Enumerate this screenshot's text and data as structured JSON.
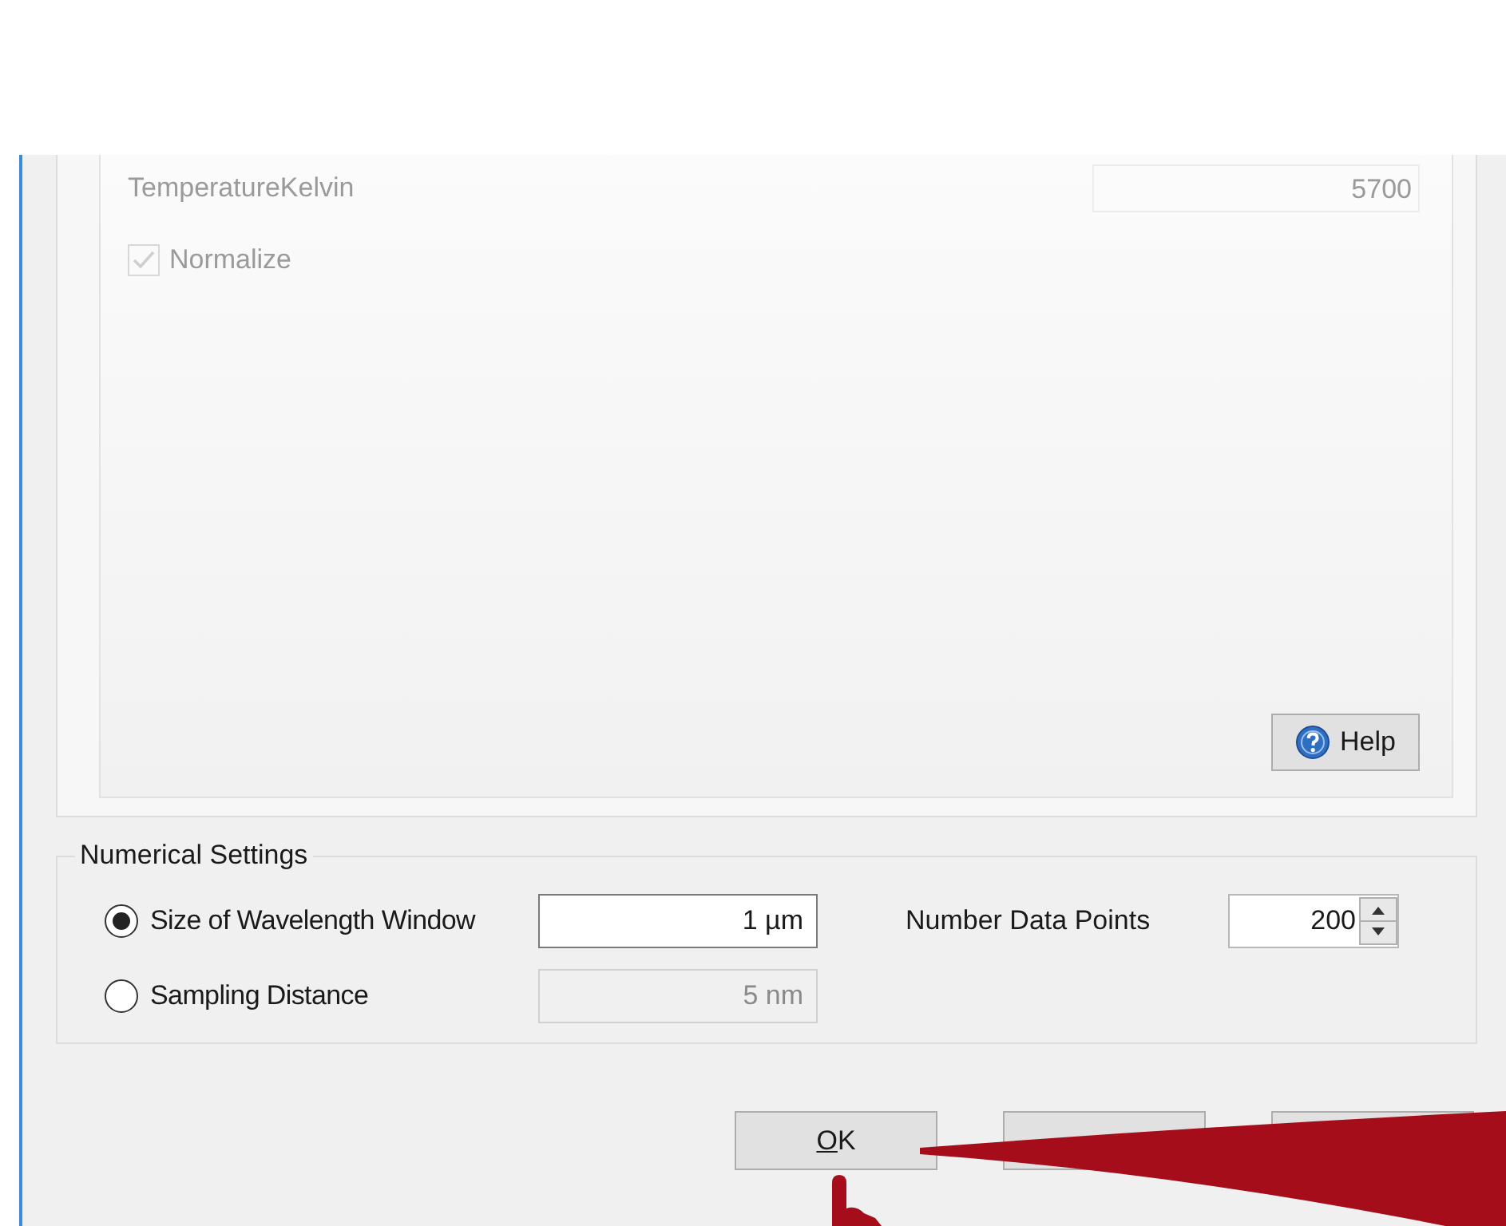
{
  "source_panel": {
    "fields": [
      {
        "label": "TemperatureKelvin",
        "value": "5700"
      }
    ],
    "checkboxes": [
      {
        "label": "Normalize",
        "checked": true
      }
    ],
    "help_button": {
      "label": "Help"
    }
  },
  "numerical_settings": {
    "title": "Numerical Settings",
    "options": [
      {
        "label": "Size of Wavelength Window",
        "selected": true,
        "value": "1 µm"
      },
      {
        "label": "Sampling Distance",
        "selected": false,
        "value": "5 nm"
      }
    ],
    "data_points": {
      "label": "Number Data Points",
      "value": "200"
    }
  },
  "footer_buttons": [
    {
      "label": "OK",
      "mnemonic_underlined": true
    },
    {
      "covered": true
    },
    {
      "covered": true
    }
  ]
}
